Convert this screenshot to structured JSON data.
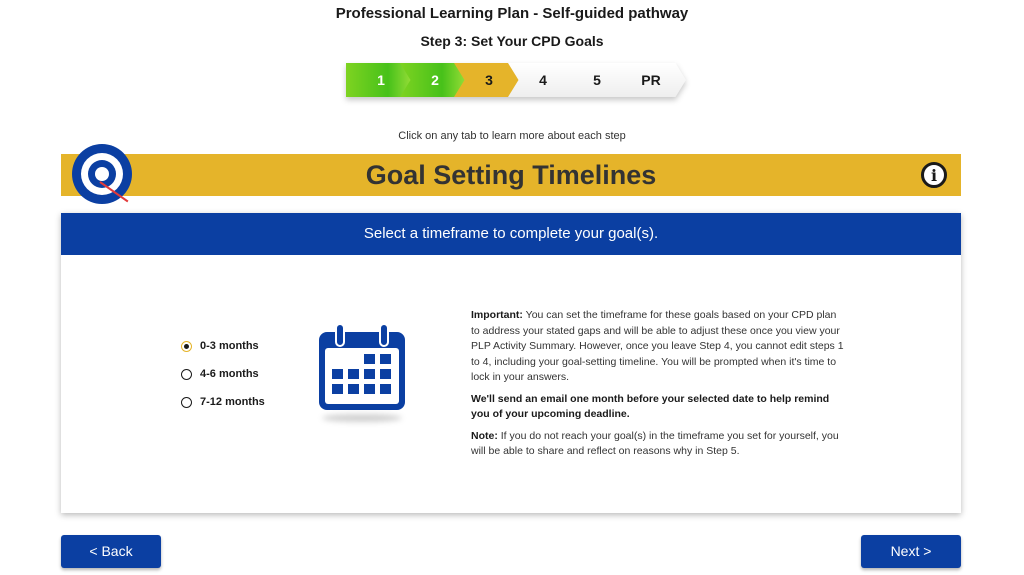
{
  "header": {
    "title": "Professional Learning Plan - Self-guided pathway",
    "step_title": "Step 3: Set Your CPD Goals"
  },
  "stepper": {
    "steps": [
      {
        "label": "1",
        "state": "done"
      },
      {
        "label": "2",
        "state": "done"
      },
      {
        "label": "3",
        "state": "current"
      },
      {
        "label": "4",
        "state": "todo"
      },
      {
        "label": "5",
        "state": "todo"
      },
      {
        "label": "PR",
        "state": "todo"
      }
    ],
    "hint": "Click on any tab to learn more about each step"
  },
  "banner": {
    "title": "Goal Setting Timelines",
    "icons": [
      "target-icon",
      "info-icon"
    ]
  },
  "card": {
    "header": "Select a timeframe to complete your goal(s).",
    "options": [
      {
        "label": "0-3 months",
        "selected": true
      },
      {
        "label": "4-6 months",
        "selected": false
      },
      {
        "label": "7-12 months",
        "selected": false
      }
    ],
    "illustration": "calendar-icon",
    "important_label": "Important:",
    "important_text": " You can set the timeframe for these goals based on your CPD plan to address your stated gaps and will be able to adjust these once you view your PLP Activity Summary. However, once you leave Step 4, you cannot edit steps 1 to 4, including your goal-setting timeline. You will be prompted when it's time to lock in your answers.",
    "email_note": "We'll send an email one month before your selected date to help remind you of your upcoming deadline.",
    "note_label": "Note:",
    "note_text": " If you do not reach your goal(s) in the timeframe you set for yourself, you will be able to share and reflect on reasons why in Step 5."
  },
  "navigation": {
    "back_label": "< Back",
    "next_label": "Next >"
  },
  "colors": {
    "brand_blue": "#0b3fa2",
    "accent_gold": "#e5b42a",
    "done_green": "#47c11a"
  }
}
